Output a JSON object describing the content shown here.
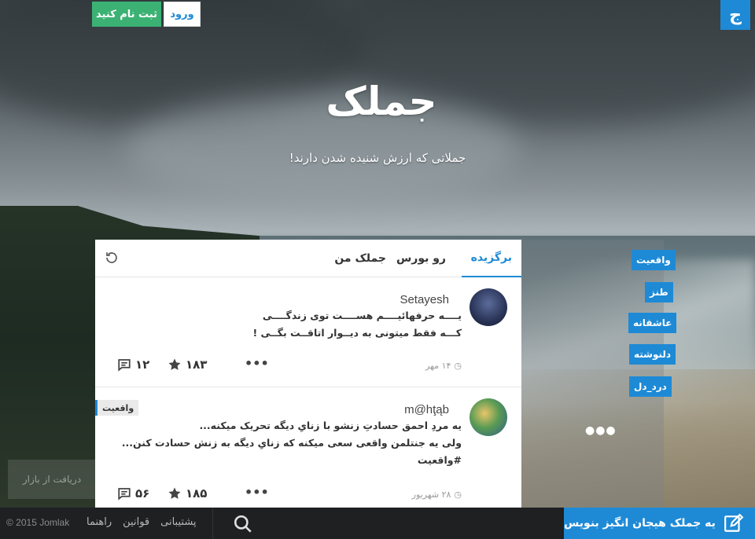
{
  "header": {
    "logo_letter": "ج",
    "login_label": "ورود",
    "signup_label": "ثبت نام کنید"
  },
  "hero": {
    "title": "جملک",
    "subtitle": "جملاتی که ارزش شنیده شدن دارند!"
  },
  "feed": {
    "tabs": [
      {
        "label": "برگزیده",
        "active": true
      },
      {
        "label": "رو بورس",
        "active": false
      },
      {
        "label": "جملک من",
        "active": false
      }
    ],
    "refresh_icon": "refresh-icon",
    "posts": [
      {
        "author": "Setayesh",
        "lines": [
          "یــــه حرفهائیــــم هســــت توی زندگــــی",
          "کـــه فقط میتونی به دیــوار اتاقــت بگــی !"
        ],
        "date": "۱۴ مهر",
        "comments": "۱۲",
        "stars": "۱۸۳",
        "category": ""
      },
      {
        "author": "m@hţąb",
        "lines": [
          "یه مردِ احمق حسادتِ زنشو با زنایِ دیگه تحریک میکنه...",
          "ولی یه جنتلمن واقعی سعی میکنه که زنایِ دیگه به زنش حسادت کنن...",
          "#واقعیت"
        ],
        "date": "۲۸ شهریور",
        "comments": "۵۶",
        "stars": "۱۸۵",
        "category": "واقعیت"
      }
    ]
  },
  "categories": [
    "واقعیت",
    "طنز",
    "عاشقانه",
    "دلنوشته",
    "درد_دل"
  ],
  "watermark": "دریافت از بازار",
  "footer": {
    "copyright": "© 2015 Jomlak",
    "links": [
      "پشتیبانی",
      "قوانین",
      "راهنما"
    ],
    "write_label": "یه جملک هیجان انگیز بنویس"
  },
  "colors": {
    "accent": "#1e8ad6",
    "signup": "#3bb273",
    "footer": "#1e2022"
  }
}
